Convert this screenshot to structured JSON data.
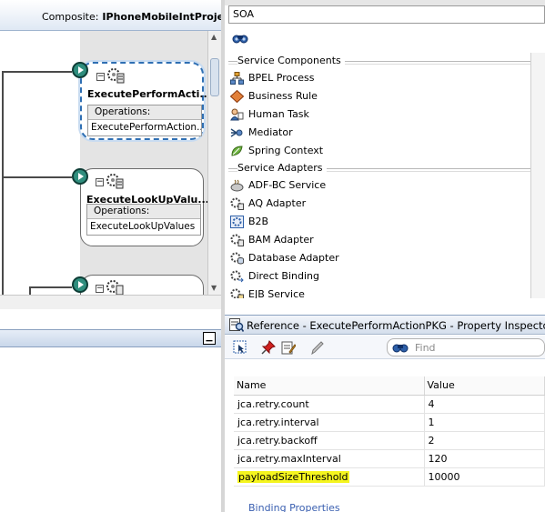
{
  "composite": {
    "label": "Composite:",
    "project": "IPhoneMobileIntProject"
  },
  "components": [
    {
      "name": "ExecutePerformActi...",
      "ops_label": "Operations:",
      "operation": "ExecutePerformAction..."
    },
    {
      "name": "ExecuteLookUpValu...",
      "ops_label": "Operations:",
      "operation": "ExecuteLookUpValues"
    }
  ],
  "palette": {
    "selected": "SOA",
    "sections": [
      {
        "label": "Service Components",
        "items": [
          "BPEL Process",
          "Business Rule",
          "Human Task",
          "Mediator",
          "Spring Context"
        ]
      },
      {
        "label": "Service Adapters",
        "items": [
          "ADF-BC Service",
          "AQ Adapter",
          "B2B",
          "BAM Adapter",
          "Database Adapter",
          "Direct Binding",
          "EJB Service"
        ]
      }
    ]
  },
  "inspector": {
    "title": "Reference - ExecutePerformActionPKG - Property Inspector",
    "find_placeholder": "Find",
    "columns": [
      "Name",
      "Value"
    ],
    "rows": [
      {
        "name": "jca.retry.count",
        "value": "4"
      },
      {
        "name": "jca.retry.interval",
        "value": "1"
      },
      {
        "name": "jca.retry.backoff",
        "value": "2"
      },
      {
        "name": "jca.retry.maxInterval",
        "value": "120"
      },
      {
        "name": "payloadSizeThreshold",
        "value": "10000"
      }
    ],
    "link": "Binding Properties"
  },
  "colors": {
    "accent": "#2f6fb3",
    "port": "#2f8e7e",
    "highlight": "#f5f51f"
  }
}
